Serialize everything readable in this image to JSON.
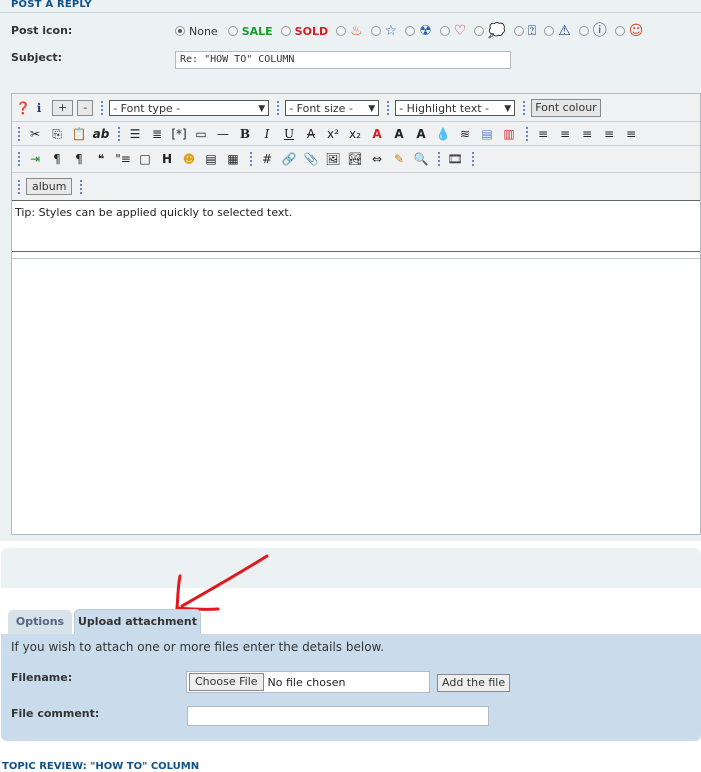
{
  "heading": "POST A REPLY",
  "post_icon": {
    "label": "Post icon:",
    "none_label": "None",
    "sale_label": "SALE",
    "sold_label": "SOLD",
    "icons": [
      "flame-icon",
      "star-icon",
      "radioactive-icon",
      "heart-icon",
      "speech-bubble-icon",
      "question-icon",
      "warning-icon",
      "info-icon",
      "smiley-icon"
    ]
  },
  "subject": {
    "label": "Subject:",
    "value": "Re: \"HOW TO\" COLUMN"
  },
  "toolbar": {
    "plus_label": "+",
    "minus_label": "-",
    "font_type": "- Font type -",
    "font_size": "- Font size -",
    "highlight": "- Highlight text -",
    "font_colour": "Font colour",
    "album_label": "album"
  },
  "editor": {
    "tip": "Tip: Styles can be applied quickly to selected text."
  },
  "tabs": [
    {
      "label": "Options"
    },
    {
      "label": "Upload attachment"
    }
  ],
  "attachment": {
    "hint": "If you wish to attach one or more files enter the details below.",
    "filename_label": "Filename:",
    "choose_label": "Choose File",
    "no_file": "No file chosen",
    "add_label": "Add the file",
    "comment_label": "File comment:"
  },
  "topic_review": "TOPIC REVIEW: \"HOW TO\" COLUMN",
  "colors": {
    "panel": "#ecf1f3",
    "attach_panel": "#cadceb",
    "heading": "#105289",
    "arrow": "#e0191f"
  }
}
